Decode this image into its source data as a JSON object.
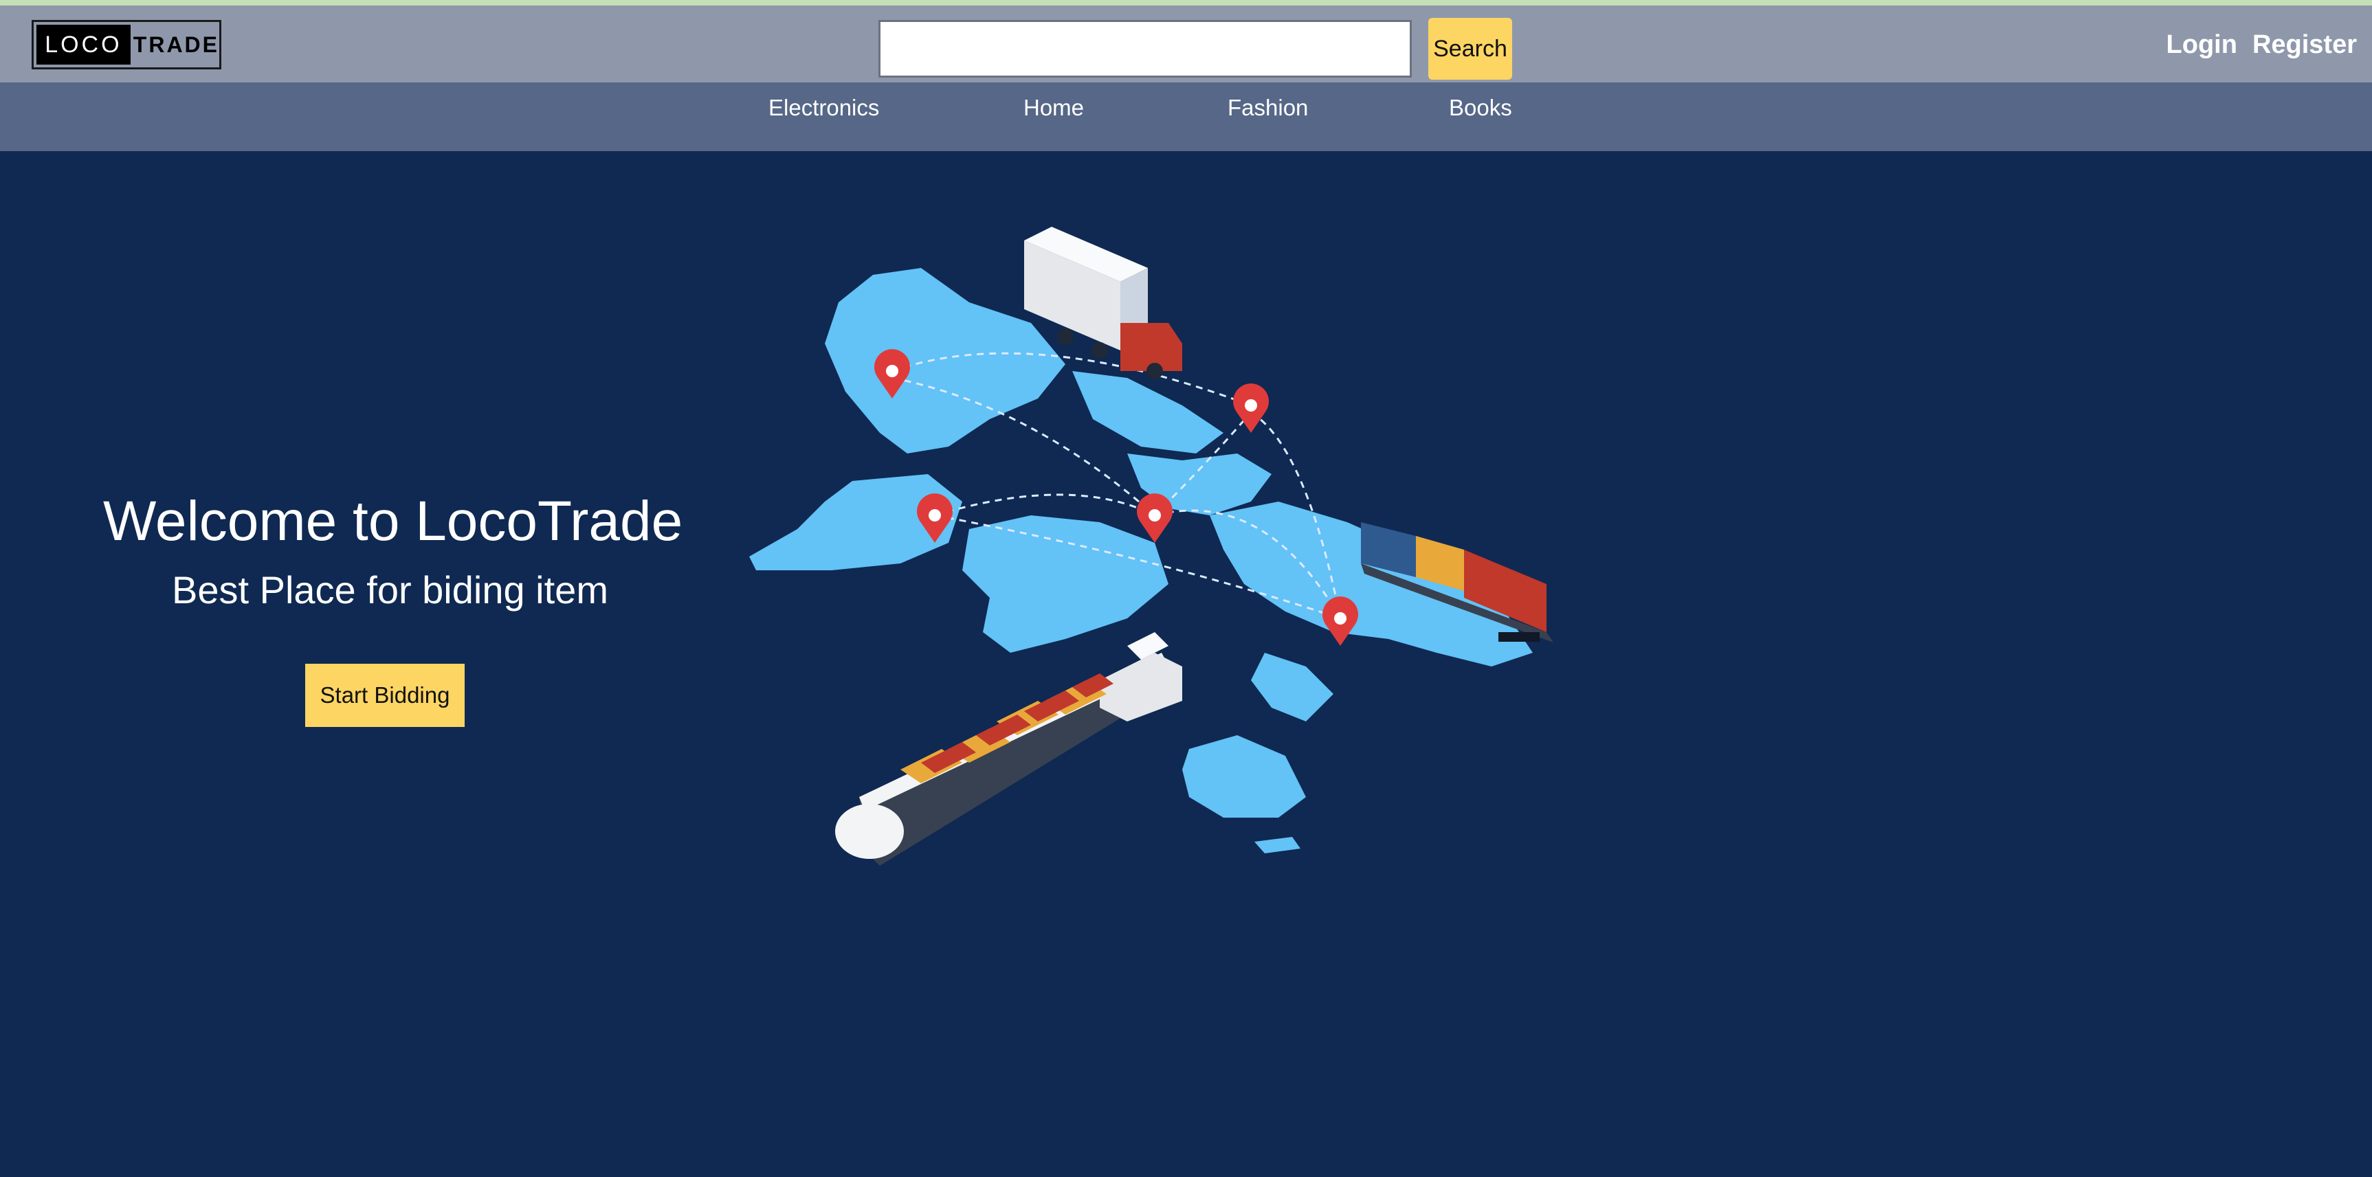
{
  "header": {
    "logo": {
      "left": "LOCO",
      "right": "TRADE"
    },
    "search": {
      "value": "",
      "placeholder": "",
      "button_label": "Search"
    },
    "auth": {
      "login": "Login",
      "register": "Register"
    }
  },
  "nav": {
    "items": [
      {
        "label": "Electronics"
      },
      {
        "label": "Home"
      },
      {
        "label": "Fashion"
      },
      {
        "label": "Books"
      }
    ]
  },
  "hero": {
    "title": "Welcome to LocoTrade",
    "subtitle": "Best Place for biding item",
    "cta_label": "Start Bidding",
    "illustration_icon": "world-logistics-illustration"
  },
  "colors": {
    "page_background": "#0f2952",
    "topbar": "#8f98ab",
    "navbar": "#566787",
    "accent_yellow": "#fdd563",
    "top_strip": "#c2dfb6"
  }
}
